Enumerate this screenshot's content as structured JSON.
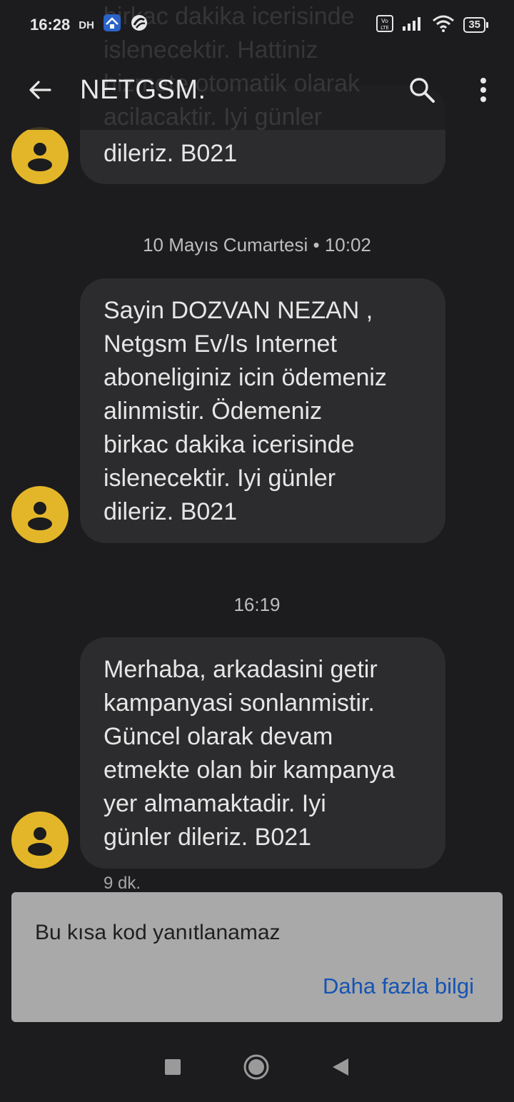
{
  "status_bar": {
    "time": "16:28",
    "carrier_tag": "DH",
    "battery": "35"
  },
  "header": {
    "title": "NETGSM."
  },
  "top_partial": {
    "ghost_lines": [
      "birkac dakika icerisinde",
      "islenecektir. Hattiniz",
      "hizmete otomatik olarak",
      "acilacaktir. Iyi günler"
    ],
    "tail_text": "dileriz. B021"
  },
  "messages": [
    {
      "date_label": "10 Mayıs Cumartesi • 10:02",
      "text": "Sayin DOZVAN NEZAN , Netgsm Ev/Is Internet aboneliginiz icin ödemeniz alinmistir. Ödemeniz birkac dakika icerisinde islenecektir. Iyi günler dileriz. B021",
      "lines": [
        "Sayin DOZVAN NEZAN ,",
        "Netgsm Ev/Is Internet",
        "aboneliginiz icin ödemeniz",
        "alinmistir. Ödemeniz",
        "birkac dakika icerisinde",
        "islenecektir. Iyi günler",
        "dileriz. B021"
      ]
    },
    {
      "date_label": "16:19",
      "text": "Merhaba, arkadasini getir kampanyasi sonlanmistir. Güncel olarak devam etmekte olan bir kampanya yer almamaktadir. Iyi günler dileriz. B021",
      "lines": [
        "Merhaba, arkadasini getir",
        "kampanyasi sonlanmistir.",
        "Güncel olarak devam",
        "etmekte olan bir kampanya",
        "yer almamaktadir. Iyi",
        "günler dileriz. B021"
      ],
      "meta": "9 dk."
    }
  ],
  "banner": {
    "text": "Bu kısa kod yanıtlanamaz",
    "link": "Daha fazla bilgi"
  },
  "colors": {
    "avatar": "#e3b62a",
    "bubble": "#2c2c2e",
    "background": "#1c1c1e",
    "link": "#1554b3"
  }
}
